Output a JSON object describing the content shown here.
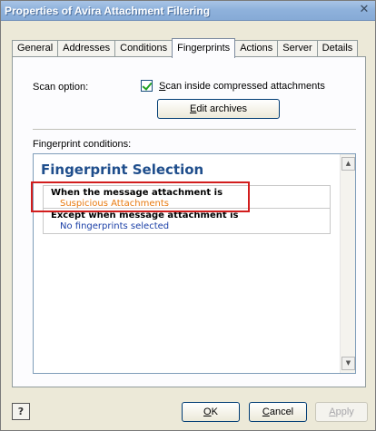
{
  "window": {
    "title": "Properties of Avira Attachment Filtering",
    "close_glyph": "✕"
  },
  "tabs": [
    {
      "label": "General",
      "active": false
    },
    {
      "label": "Addresses",
      "active": false
    },
    {
      "label": "Conditions",
      "active": false
    },
    {
      "label": "Fingerprints",
      "active": true
    },
    {
      "label": "Actions",
      "active": false
    },
    {
      "label": "Server",
      "active": false
    },
    {
      "label": "Details",
      "active": false
    }
  ],
  "scan": {
    "label": "Scan option:",
    "checkbox_label": "Scan inside compressed attachments",
    "checked": true,
    "edit_button": "Edit archives"
  },
  "fingerprint": {
    "conditions_label": "Fingerprint conditions:",
    "heading": "Fingerprint Selection",
    "rules": [
      {
        "title": "When the message attachment is",
        "value": "Suspicious Attachments"
      },
      {
        "title": "Except when message attachment is",
        "value": "No fingerprints selected"
      }
    ]
  },
  "footer": {
    "help_icon": "help-icon",
    "ok": "OK",
    "cancel": "Cancel",
    "apply": "Apply"
  },
  "colors": {
    "heading": "#1f4e8c",
    "highlight_box": "#d21d1d",
    "rule_value_primary": "#e87a10",
    "rule_value_secondary": "#1a3fa6"
  }
}
